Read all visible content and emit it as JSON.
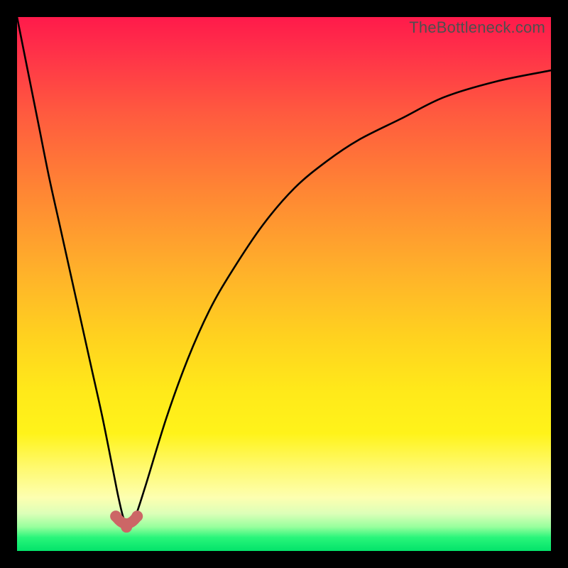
{
  "watermark": "TheBottleneck.com",
  "colors": {
    "frame": "#000000",
    "curve": "#000000",
    "marker": "#CC6666",
    "gradient_top": "#ff1a4b",
    "gradient_bottom": "#04e36a"
  },
  "chart_data": {
    "type": "line",
    "title": "",
    "xlabel": "",
    "ylabel": "",
    "xlim": [
      0,
      100
    ],
    "ylim": [
      0,
      100
    ],
    "grid": false,
    "legend": false,
    "notes": "V-shaped bottleneck curve. x ≈ relative component capability (0–100). y ≈ bottleneck percentage (0–100, 0 is best/green, 100 is worst/red). Minimum of the curve (optimal match) is near x ≈ 20, y ≈ 4. Left branch is steep/near-linear; right branch rises and saturates toward ~90%.",
    "series": [
      {
        "name": "bottleneck_curve",
        "x": [
          0,
          2,
          4,
          6,
          8,
          10,
          12,
          14,
          16,
          18,
          19,
          20,
          21,
          22,
          24,
          28,
          32,
          36,
          40,
          46,
          52,
          58,
          64,
          72,
          80,
          90,
          100
        ],
        "y": [
          100,
          90,
          80,
          70,
          61,
          52,
          43,
          34,
          25,
          15,
          10,
          6,
          5,
          6,
          12,
          25,
          36,
          45,
          52,
          61,
          68,
          73,
          77,
          81,
          85,
          88,
          90
        ]
      }
    ],
    "markers": [
      {
        "name": "valley_left",
        "x": 18.5,
        "y": 6.5
      },
      {
        "name": "valley_mid",
        "x": 20.5,
        "y": 4.5
      },
      {
        "name": "valley_right",
        "x": 22.5,
        "y": 6.5
      }
    ]
  }
}
